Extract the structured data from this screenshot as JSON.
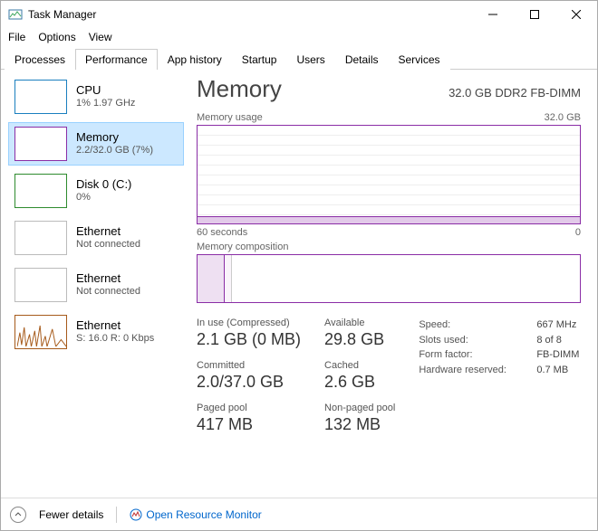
{
  "window": {
    "title": "Task Manager"
  },
  "menus": [
    "File",
    "Options",
    "View"
  ],
  "tabs": [
    "Processes",
    "Performance",
    "App history",
    "Startup",
    "Users",
    "Details",
    "Services"
  ],
  "active_tab": 1,
  "sidebar": {
    "items": [
      {
        "title": "CPU",
        "subtitle": "1% 1.97 GHz"
      },
      {
        "title": "Memory",
        "subtitle": "2.2/32.0 GB (7%)"
      },
      {
        "title": "Disk 0 (C:)",
        "subtitle": "0%"
      },
      {
        "title": "Ethernet",
        "subtitle": "Not connected"
      },
      {
        "title": "Ethernet",
        "subtitle": "Not connected"
      },
      {
        "title": "Ethernet",
        "subtitle": "S: 16.0 R: 0 Kbps"
      }
    ]
  },
  "panel": {
    "title": "Memory",
    "spec": "32.0 GB DDR2 FB-DIMM",
    "usage_label": "Memory usage",
    "usage_scale_max": "32.0 GB",
    "axis_left": "60 seconds",
    "axis_right": "0",
    "comp_label": "Memory composition",
    "stats": {
      "in_use_lbl": "In use (Compressed)",
      "in_use_val": "2.1 GB (0 MB)",
      "avail_lbl": "Available",
      "avail_val": "29.8 GB",
      "commit_lbl": "Committed",
      "commit_val": "2.0/37.0 GB",
      "cached_lbl": "Cached",
      "cached_val": "2.6 GB",
      "paged_lbl": "Paged pool",
      "paged_val": "417 MB",
      "nonpaged_lbl": "Non-paged pool",
      "nonpaged_val": "132 MB"
    },
    "details": {
      "speed_k": "Speed:",
      "speed_v": "667 MHz",
      "slots_k": "Slots used:",
      "slots_v": "8 of 8",
      "form_k": "Form factor:",
      "form_v": "FB-DIMM",
      "hw_k": "Hardware reserved:",
      "hw_v": "0.7 MB"
    }
  },
  "footer": {
    "fewer": "Fewer details",
    "orm": "Open Resource Monitor"
  },
  "chart_data": {
    "type": "line",
    "title": "Memory usage",
    "xlabel": "seconds",
    "ylabel": "GB",
    "xlim": [
      0,
      60
    ],
    "ylim": [
      0,
      32.0
    ],
    "x": [
      60,
      55,
      50,
      45,
      40,
      35,
      30,
      25,
      20,
      15,
      10,
      5,
      0
    ],
    "values": [
      2.2,
      2.2,
      2.2,
      2.2,
      2.2,
      2.2,
      2.2,
      2.2,
      2.2,
      2.2,
      2.2,
      2.2,
      2.2
    ]
  }
}
